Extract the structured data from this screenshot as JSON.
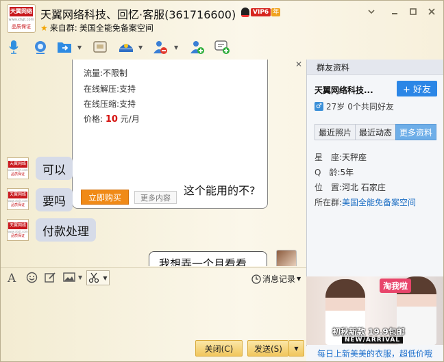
{
  "window": {
    "title": "天翼网络科技、回忆·客服(361716600)",
    "vip_label": "VIP6",
    "vip_year": "年",
    "from_group_prefix": "来自群:",
    "from_group_name": "美国全能免备案空间",
    "logo_text": "天翼网络",
    "logo_url": "www.xtyjt.com",
    "logo_badge": "品质保证"
  },
  "toolbar_icons": [
    "microphone-icon",
    "video-icon",
    "send-file-icon",
    "remote-screen-icon",
    "app-icon",
    "block-user-icon",
    "add-contact-icon",
    "add-chat-icon"
  ],
  "card": {
    "rows": [
      "流量:不限制",
      "在线解压:支持",
      "在线压缩:支持"
    ],
    "price_label": "价格:",
    "price_value": "10",
    "price_unit": "元/月",
    "buy_label": "立即购买",
    "more_label": "更多内容",
    "question": "这个能用的不?"
  },
  "messages": [
    {
      "text": "可以"
    },
    {
      "text": "要吗"
    },
    {
      "text": "付款处理"
    }
  ],
  "my_message": "我想弄一个月看看",
  "input_toolbar": {
    "history_label": "消息记录"
  },
  "buttons": {
    "close": "关闭(C)",
    "send": "发送(S)"
  },
  "profile": {
    "header": "群友资料",
    "name": "天翼网络科技...",
    "add_friend": "+ 好友",
    "age": "27岁",
    "mutual": "0个共同好友",
    "tabs": [
      "最近照片",
      "最近动态",
      "更多资料"
    ],
    "active_tab": 2,
    "fields": [
      {
        "label": "星　座:",
        "value": "天秤座"
      },
      {
        "label": "Q　龄:",
        "value": "5年"
      },
      {
        "label": "位　置:",
        "value": "河北 石家庄"
      },
      {
        "label": "所在群:",
        "value": "美国全能免备案空间"
      }
    ]
  },
  "ad": {
    "badge": "淘我啦",
    "promo": "初秋新款 19.9包邮",
    "arrival": "NEW/ARRIVAL",
    "caption": "每日上新美美的衣服，超低价哦"
  }
}
